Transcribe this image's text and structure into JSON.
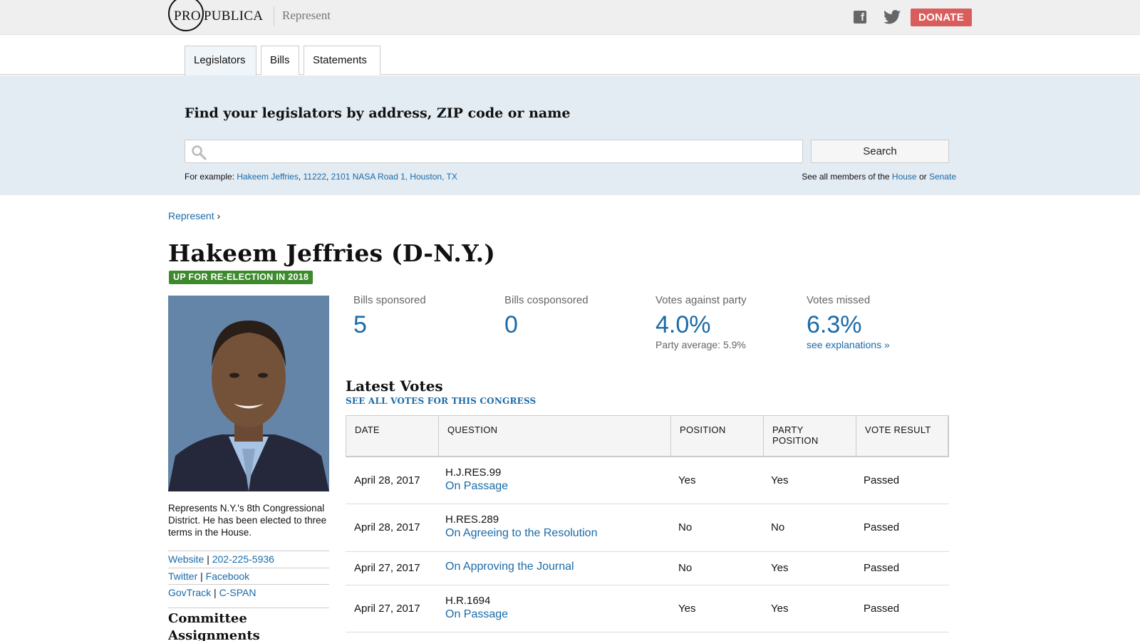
{
  "header": {
    "logo_pro": "PRO",
    "logo_publica": "PUBLICA",
    "app_title": "Represent",
    "donate_label": "DONATE"
  },
  "tabs": [
    {
      "label": "Legislators",
      "active": true
    },
    {
      "label": "Bills",
      "active": false
    },
    {
      "label": "Statements",
      "active": false
    }
  ],
  "search": {
    "heading": "Find your legislators by address, ZIP code or name",
    "placeholder": "",
    "button_label": "Search",
    "examples_prefix": "For example: ",
    "examples": [
      "Hakeem Jeffries",
      "11222",
      "2101 NASA Road 1, Houston, TX"
    ],
    "see_all_prefix": "See all members of the ",
    "see_all_house": "House",
    "see_all_or": " or ",
    "see_all_senate": "Senate"
  },
  "breadcrumb": {
    "link": "Represent",
    "separator": "›"
  },
  "legislator": {
    "name": "Hakeem Jeffries (D-N.Y.)",
    "badge": "UP FOR RE-ELECTION IN 2018",
    "bio": "Represents N.Y.'s 8th Congressional District. He has been elected to three terms in the House.",
    "links": [
      [
        "Website",
        "202-225-5936"
      ],
      [
        "Twitter",
        "Facebook"
      ],
      [
        "GovTrack",
        "C-SPAN"
      ]
    ],
    "link_separator": "|",
    "committee_heading": "Committee Assignments"
  },
  "stats": [
    {
      "label": "Bills sponsored",
      "value": "5",
      "sub": "",
      "sub_link": ""
    },
    {
      "label": "Bills cosponsored",
      "value": "0",
      "sub": "",
      "sub_link": ""
    },
    {
      "label": "Votes against party",
      "value": "4.0%",
      "sub": "Party average: 5.9%",
      "sub_link": ""
    },
    {
      "label": "Votes missed",
      "value": "6.3%",
      "sub": "",
      "sub_link": "see explanations »"
    }
  ],
  "votes": {
    "heading": "Latest Votes",
    "see_all": "SEE ALL VOTES FOR THIS CONGRESS",
    "columns": [
      "DATE",
      "QUESTION",
      "POSITION",
      "PARTY POSITION",
      "VOTE RESULT"
    ],
    "rows": [
      {
        "date": "April 28, 2017",
        "bill": "H.J.RES.99",
        "question": "On Passage",
        "position": "Yes",
        "party_position": "Yes",
        "result": "Passed"
      },
      {
        "date": "April 28, 2017",
        "bill": "H.RES.289",
        "question": "On Agreeing to the Resolution",
        "position": "No",
        "party_position": "No",
        "result": "Passed"
      },
      {
        "date": "April 27, 2017",
        "bill": "",
        "question": "On Approving the Journal",
        "position": "No",
        "party_position": "Yes",
        "result": "Passed"
      },
      {
        "date": "April 27, 2017",
        "bill": "H.R.1694",
        "question": "On Passage",
        "position": "Yes",
        "party_position": "Yes",
        "result": "Passed"
      }
    ]
  },
  "colors": {
    "link": "#1a6ba8",
    "donate": "#d95d5d",
    "badge": "#3d8a2c",
    "search_band": "#e3ebf3"
  },
  "icons": {
    "facebook": "facebook-icon",
    "twitter": "twitter-icon",
    "search": "search-icon"
  }
}
